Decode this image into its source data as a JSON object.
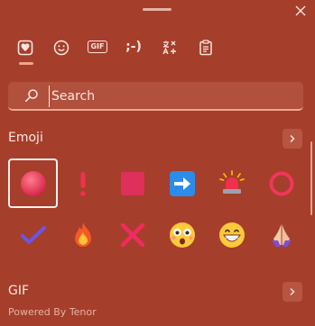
{
  "close": {
    "icon": "close-icon"
  },
  "tabs": [
    {
      "name": "most-recently-used",
      "icon": "heart-icon",
      "active": true
    },
    {
      "name": "emoji",
      "icon": "smiley-icon",
      "active": false
    },
    {
      "name": "gif",
      "label": "GIF",
      "icon": "gif-icon",
      "active": false
    },
    {
      "name": "kaomoji",
      "label": ";-)",
      "icon": "kaomoji-icon",
      "active": false
    },
    {
      "name": "symbols",
      "icon": "symbols-icon",
      "active": false
    },
    {
      "name": "clipboard",
      "icon": "clipboard-icon",
      "active": false
    }
  ],
  "search": {
    "placeholder": "Search",
    "icon": "search-icon"
  },
  "emoji_section": {
    "title": "Emoji",
    "items": [
      {
        "name": "red-circle",
        "selected": true
      },
      {
        "name": "exclamation-mark"
      },
      {
        "name": "red-square"
      },
      {
        "name": "right-arrow"
      },
      {
        "name": "police-light"
      },
      {
        "name": "hollow-red-circle"
      },
      {
        "name": "check-mark"
      },
      {
        "name": "fire"
      },
      {
        "name": "cross-mark"
      },
      {
        "name": "astonished-face"
      },
      {
        "name": "grinning-face"
      },
      {
        "name": "folded-hands"
      }
    ]
  },
  "gif_section": {
    "title": "GIF",
    "powered_by": "Powered By Tenor"
  },
  "colors": {
    "background": "#a53e2b",
    "accent": "#f2a489",
    "text": "#fbe7df"
  }
}
